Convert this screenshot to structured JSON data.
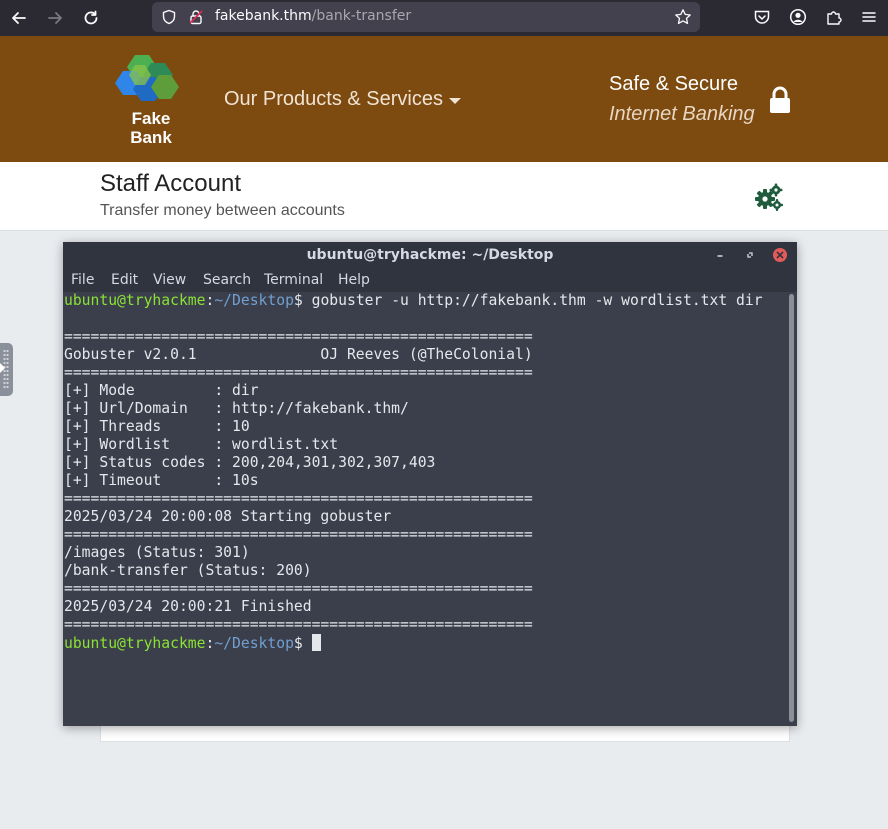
{
  "browser": {
    "url_host": "fakebank.thm",
    "url_path": "/bank-transfer"
  },
  "site": {
    "logo_line1": "Fake",
    "logo_line2": "Bank",
    "nav_products": "Our Products & Services",
    "secure_line1": "Safe & Secure",
    "secure_line2": "Internet Banking",
    "brand_color": "#7d4a10"
  },
  "account": {
    "title": "Staff Account",
    "subtitle": "Transfer money between accounts"
  },
  "terminal": {
    "title": "ubuntu@tryhackme: ~/Desktop",
    "menu": [
      "File",
      "Edit",
      "View",
      "Search",
      "Terminal",
      "Help"
    ],
    "prompt_user": "ubuntu@tryhackme",
    "prompt_path": "~/Desktop",
    "command": " gobuster -u http://fakebank.thm -w wordlist.txt dir",
    "lines": [
      "",
      "=====================================================",
      "Gobuster v2.0.1              OJ Reeves (@TheColonial)",
      "=====================================================",
      "[+] Mode         : dir",
      "[+] Url/Domain   : http://fakebank.thm/",
      "[+] Threads      : 10",
      "[+] Wordlist     : wordlist.txt",
      "[+] Status codes : 200,204,301,302,307,403",
      "[+] Timeout      : 10s",
      "=====================================================",
      "2025/03/24 20:00:08 Starting gobuster",
      "=====================================================",
      "/images (Status: 301)",
      "/bank-transfer (Status: 200)",
      "=====================================================",
      "2025/03/24 20:00:21 Finished",
      "====================================================="
    ]
  }
}
